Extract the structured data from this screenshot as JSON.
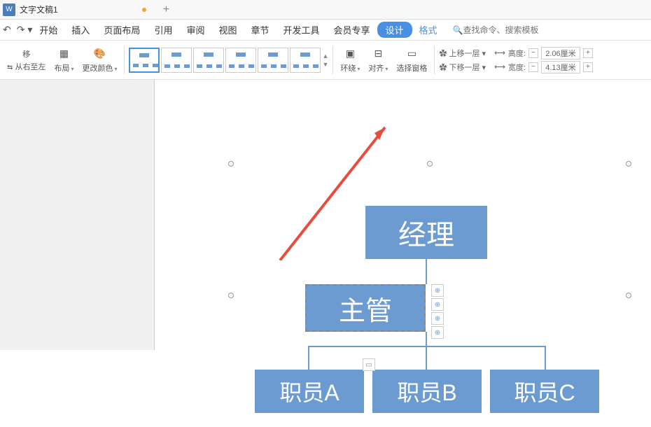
{
  "titlebar": {
    "icon": "W",
    "title": "文字文稿1",
    "new_tab": "+"
  },
  "menu": {
    "items": [
      "开始",
      "插入",
      "页面布局",
      "引用",
      "审阅",
      "视图",
      "章节",
      "开发工具",
      "会员专享",
      "设计",
      "格式"
    ],
    "active_index": 9,
    "blue_index": 10,
    "search_placeholder": "查找命令、搜索模板"
  },
  "toolbar": {
    "move": "移",
    "rtl": "从右至左",
    "layout": "布局",
    "change_color": "更改颜色",
    "wrap": "环绕",
    "align": "对齐",
    "select_pane": "选择窗格",
    "up_layer": "上移一层",
    "down_layer": "下移一层",
    "height_label": "高度:",
    "width_label": "宽度:",
    "height_value": "2.06厘米",
    "width_value": "4.13厘米"
  },
  "org": {
    "manager": "经理",
    "supervisor": "主管",
    "emp_a": "职员A",
    "emp_b": "职员B",
    "emp_c": "职员C"
  }
}
